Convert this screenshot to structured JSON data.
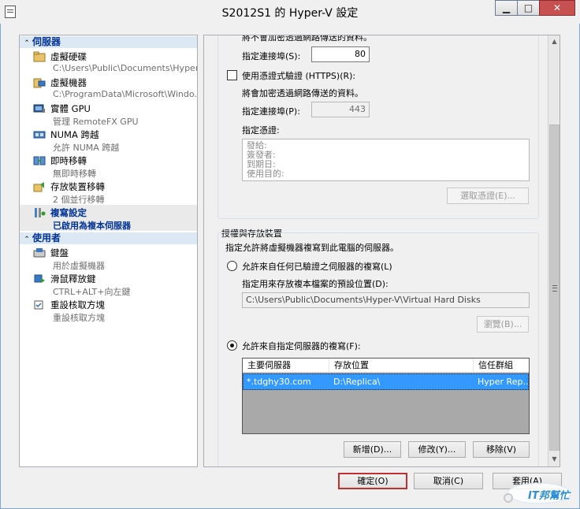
{
  "window": {
    "title": "S2012S1 的 Hyper-V 設定"
  },
  "left_nav": {
    "server_category": "伺服器",
    "user_category": "使用者",
    "server_items": [
      {
        "label": "虛擬硬碟",
        "sub": "C:\\Users\\Public\\Documents\\Hyper-..."
      },
      {
        "label": "虛擬機器",
        "sub": "C:\\ProgramData\\Microsoft\\Windo..."
      },
      {
        "label": "實體 GPU",
        "sub": "管理 RemoteFX GPU"
      },
      {
        "label": "NUMA 跨越",
        "sub": "允許 NUMA 跨越"
      },
      {
        "label": "即時移轉",
        "sub": "無即時移轉"
      },
      {
        "label": "存放裝置移轉",
        "sub": "2 個並行移轉"
      },
      {
        "label": "複寫設定",
        "sub": "已啟用為複本伺服器"
      }
    ],
    "user_items": [
      {
        "label": "鍵盤",
        "sub": "用於虛擬機器"
      },
      {
        "label": "滑鼠釋放鍵",
        "sub": "CTRL+ALT+向左鍵"
      },
      {
        "label": "重設核取方塊",
        "sub": "重設核取方塊"
      }
    ]
  },
  "http": {
    "cut_text": "將不會加密透過網路傳送的資料。",
    "port_label": "指定連接埠(S):",
    "port_value": "80"
  },
  "https": {
    "checkbox_label": "使用憑證式驗證 (HTTPS)(R):",
    "note": "將會加密透過網路傳送的資料。",
    "port_label": "指定連接埠(P):",
    "port_value": "443",
    "cert_label": "指定憑證:",
    "cert_fields": [
      "發給:",
      "簽發者:",
      "到期日:",
      "使用目的:"
    ],
    "select_cert_button": "選取憑證(E)..."
  },
  "auth": {
    "group_title": "授權與存放裝置",
    "desc": "指定允許將虛擬機器複寫到此電腦的伺服器。",
    "radio_any": "允許來自任何已驗證之伺服器的複寫(L)",
    "default_location_label": "指定用來存放複本檔案的預設位置(D):",
    "default_location_value": "C:\\Users\\Public\\Documents\\Hyper-V\\Virtual Hard Disks",
    "browse_button": "瀏覽(B)...",
    "radio_specified": "允許來自指定伺服器的複寫(F):",
    "table_headers": [
      "主要伺服器",
      "存放位置",
      "信任群組"
    ],
    "table_rows": [
      [
        "*.tdghy30.com",
        "D:\\Replica\\",
        "Hyper Rep..."
      ]
    ],
    "add_button": "新增(D)...",
    "edit_button": "修改(Y)...",
    "remove_button": "移除(V)"
  },
  "footer": {
    "ok": "確定(O)",
    "cancel": "取消(C)",
    "apply": "套用(A)"
  },
  "watermark": {
    "text": "IT邦幫忙"
  },
  "colors": {
    "selection": "#3399ff",
    "category_text": "#003399",
    "ok_border": "#c0302c"
  }
}
